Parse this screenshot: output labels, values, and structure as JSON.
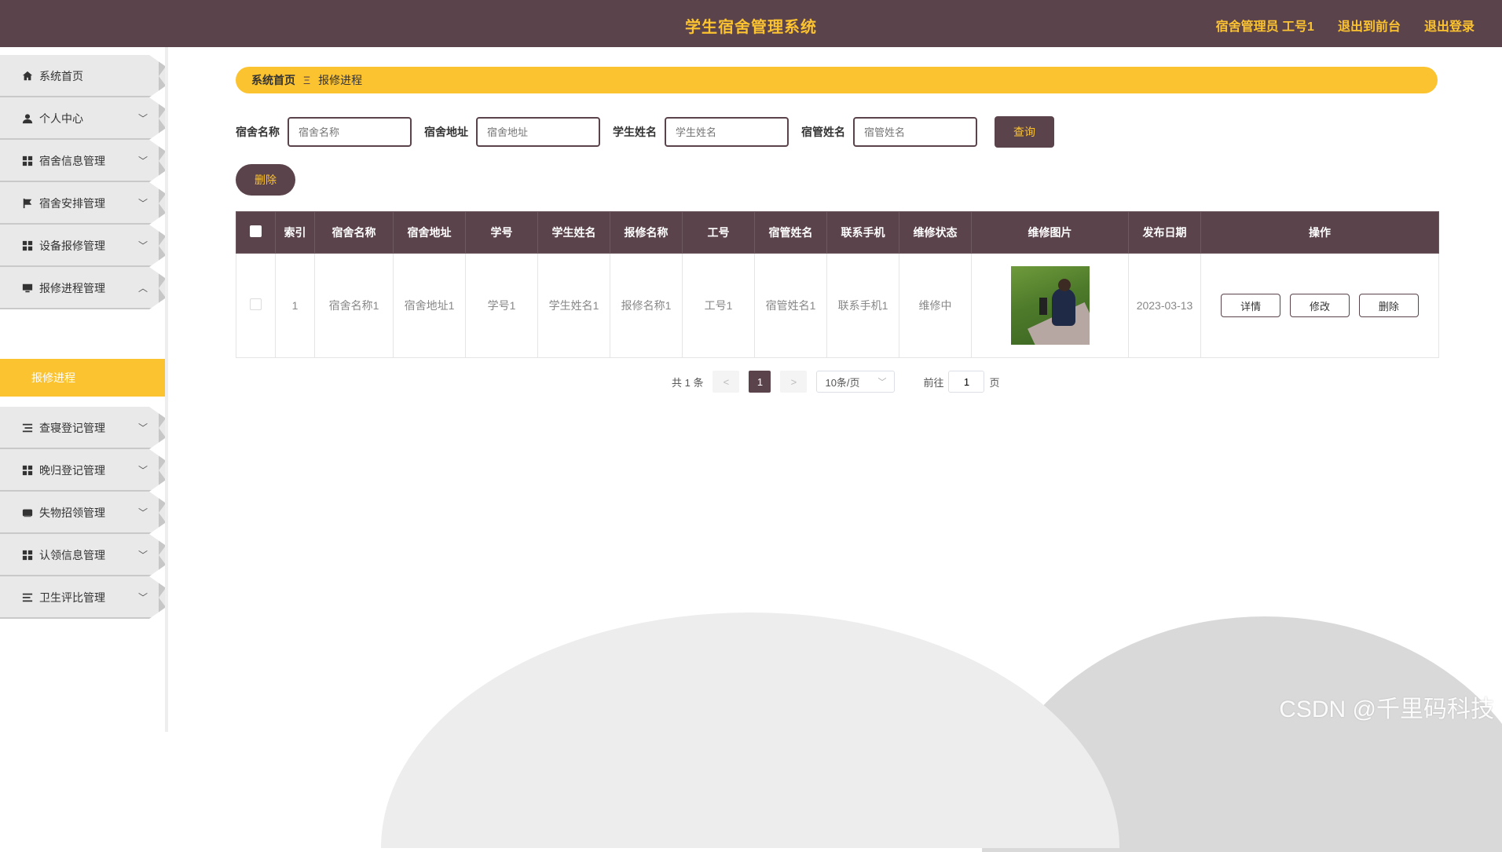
{
  "header": {
    "title": "学生宿舍管理系统",
    "user": "宿舍管理员 工号1",
    "to_front": "退出到前台",
    "logout": "退出登录"
  },
  "sidebar": {
    "items": [
      {
        "label": "系统首页",
        "icon": "home-icon"
      },
      {
        "label": "个人中心",
        "icon": "user-icon"
      },
      {
        "label": "宿舍信息管理",
        "icon": "grid-icon"
      },
      {
        "label": "宿舍安排管理",
        "icon": "flag-icon"
      },
      {
        "label": "设备报修管理",
        "icon": "grid-icon"
      },
      {
        "label": "报修进程管理",
        "icon": "monitor-icon"
      },
      {
        "label": "查寝登记管理",
        "icon": "list-icon"
      },
      {
        "label": "晚归登记管理",
        "icon": "grid-icon"
      },
      {
        "label": "失物招领管理",
        "icon": "box-icon"
      },
      {
        "label": "认领信息管理",
        "icon": "grid-icon"
      },
      {
        "label": "卫生评比管理",
        "icon": "list-icon"
      }
    ],
    "active_sub": "报修进程"
  },
  "breadcrumb": {
    "home": "系统首页",
    "separator": "Ξ",
    "current": "报修进程"
  },
  "search": {
    "fields": [
      {
        "label": "宿舍名称",
        "placeholder": "宿舍名称"
      },
      {
        "label": "宿舍地址",
        "placeholder": "宿舍地址"
      },
      {
        "label": "学生姓名",
        "placeholder": "学生姓名"
      },
      {
        "label": "宿管姓名",
        "placeholder": "宿管姓名"
      }
    ],
    "query_label": "查询"
  },
  "delete_label": "删除",
  "table": {
    "columns": [
      "索引",
      "宿舍名称",
      "宿舍地址",
      "学号",
      "学生姓名",
      "报修名称",
      "工号",
      "宿管姓名",
      "联系手机",
      "维修状态",
      "维修图片",
      "发布日期",
      "操作"
    ],
    "rows": [
      {
        "index": "1",
        "dorm_name": "宿舍名称1",
        "dorm_addr": "宿舍地址1",
        "student_no": "学号1",
        "student_name": "学生姓名1",
        "repair_name": "报修名称1",
        "staff_no": "工号1",
        "manager_name": "宿管姓名1",
        "phone": "联系手机1",
        "status": "维修中",
        "date": "2023-03-13"
      }
    ],
    "actions": {
      "detail": "详情",
      "edit": "修改",
      "delete": "删除"
    }
  },
  "pagination": {
    "total": "共 1 条",
    "prev": "<",
    "page": "1",
    "next": ">",
    "page_size": "10条/页",
    "goto_prefix": "前往",
    "goto_value": "1",
    "goto_suffix": "页"
  },
  "watermark": "CSDN @千里码科技",
  "colors": {
    "brand": "#5b434b",
    "accent": "#fbc330"
  }
}
